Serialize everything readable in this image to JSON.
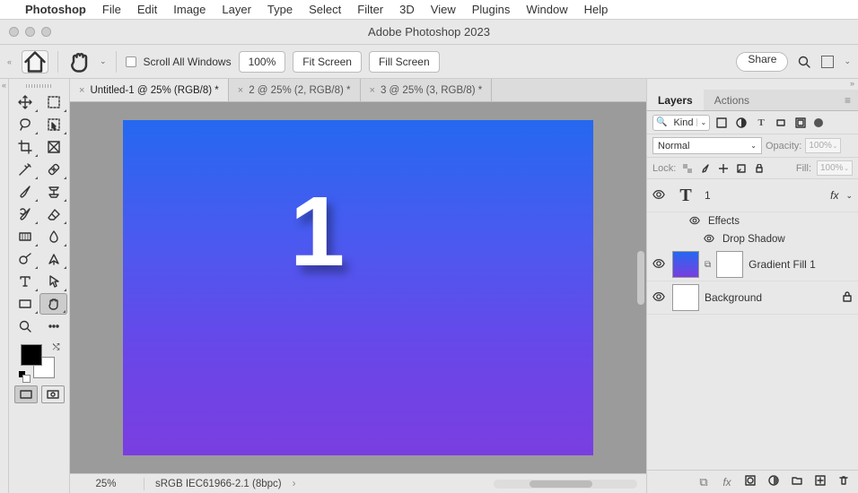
{
  "menubar": {
    "app": "Photoshop",
    "items": [
      "File",
      "Edit",
      "Image",
      "Layer",
      "Type",
      "Select",
      "Filter",
      "3D",
      "View",
      "Plugins",
      "Window",
      "Help"
    ]
  },
  "titlebar": {
    "title": "Adobe Photoshop 2023"
  },
  "optionsbar": {
    "scroll_all_label": "Scroll All Windows",
    "zoom_value": "100%",
    "fit_label": "Fit Screen",
    "fill_label": "Fill Screen",
    "share_label": "Share"
  },
  "tabs": [
    {
      "label": "Untitled-1 @ 25% (RGB/8) *",
      "active": true
    },
    {
      "label": "2 @ 25% (2, RGB/8) *",
      "active": false
    },
    {
      "label": "3 @ 25% (3, RGB/8) *",
      "active": false
    }
  ],
  "canvas": {
    "text": "1"
  },
  "statusbar": {
    "zoom": "25%",
    "profile": "sRGB IEC61966-2.1 (8bpc)"
  },
  "panels": {
    "layers_tab": "Layers",
    "actions_tab": "Actions",
    "kind_label": "Kind",
    "blend_mode": "Normal",
    "opacity_label": "Opacity:",
    "opacity_value": "100%",
    "lock_label": "Lock:",
    "fill_label": "Fill:",
    "fill_value": "100%",
    "layers": {
      "l1_name": "1",
      "l1_fx": "fx",
      "l1_effects": "Effects",
      "l1_dropshadow": "Drop Shadow",
      "l2_name": "Gradient Fill 1",
      "l3_name": "Background"
    }
  }
}
